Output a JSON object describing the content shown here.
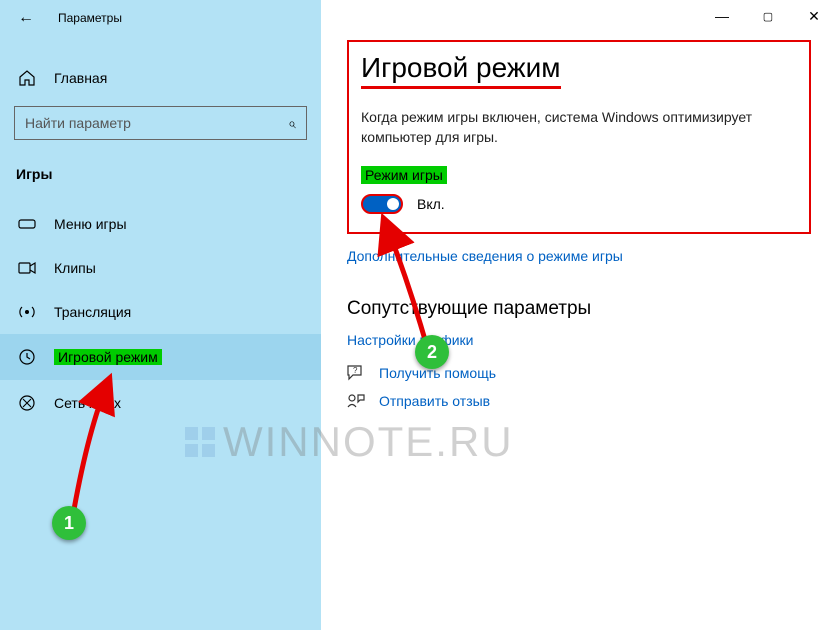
{
  "window": {
    "title": "Параметры",
    "chrome": {
      "min": "—",
      "max": "▢",
      "close": "✕"
    }
  },
  "sidebar": {
    "back_glyph": "←",
    "home_glyph": "⌂",
    "home_label": "Главная",
    "search_placeholder": "Найти параметр",
    "search_glyph": "⌕",
    "section_title": "Игры",
    "items": [
      {
        "label": "Меню игры",
        "icon": "menu"
      },
      {
        "label": "Клипы",
        "icon": "clips"
      },
      {
        "label": "Трансляция",
        "icon": "broadcast"
      },
      {
        "label": "Игровой режим",
        "icon": "gamemode",
        "selected": true
      },
      {
        "label": "Сеть Xbox",
        "icon": "xbox"
      }
    ]
  },
  "main": {
    "title": "Игровой режим",
    "description": "Когда режим игры включен, система Windows оптимизирует компьютер для игры.",
    "toggle_label": "Режим игры",
    "toggle_state": "Вкл.",
    "more_link": "Дополнительные сведения о режиме игры",
    "related_title": "Сопутствующие параметры",
    "related_link": "Настройки графики",
    "help_link": "Получить помощь",
    "feedback_link": "Отправить отзыв"
  },
  "watermark": "WINNOTE.RU",
  "annotations": {
    "step1": "1",
    "step2": "2"
  },
  "colors": {
    "accent": "#0061c3",
    "highlight": "#00cc00",
    "box": "#e40000"
  }
}
